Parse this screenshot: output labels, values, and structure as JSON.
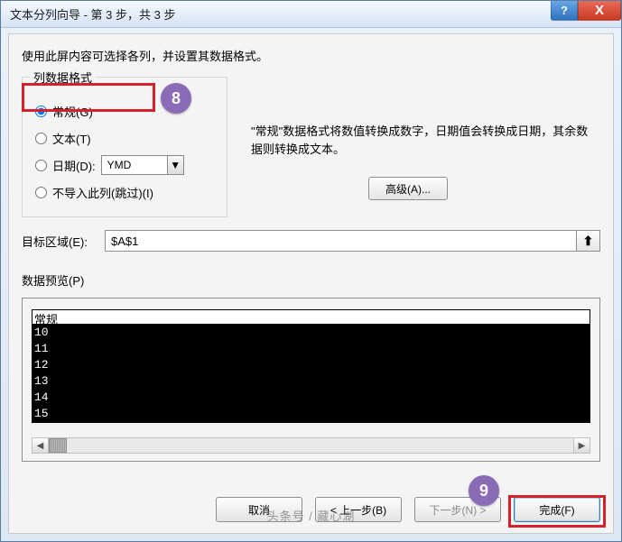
{
  "title": "文本分列向导 - 第 3 步，共 3 步",
  "intro": "使用此屏内容可选择各列，并设置其数据格式。",
  "format_group": {
    "legend": "列数据格式",
    "general": "常规(G)",
    "text": "文本(T)",
    "date": "日期(D):",
    "date_value": "YMD",
    "skip": "不导入此列(跳过)(I)"
  },
  "desc": "\"常规\"数据格式将数值转换成数字，日期值会转换成日期，其余数据则转换成文本。",
  "advanced": "高级(A)...",
  "dest_label": "目标区域(E):",
  "dest_value": "$A$1",
  "preview_label": "数据预览(P)",
  "preview_header": "常规",
  "preview_rows": [
    "10",
    "11",
    "12",
    "13",
    "14",
    "15"
  ],
  "buttons": {
    "cancel": "取消",
    "back": "< 上一步(B)",
    "next": "下一步(N) >",
    "finish": "完成(F)"
  },
  "badges": {
    "b8": "8",
    "b9": "9"
  },
  "watermark": "头条号 / 藏心湖",
  "icons": {
    "help": "?",
    "close": "X",
    "up_arrow": "⬆",
    "down_tri": "▼",
    "left_tri": "◀",
    "right_tri": "▶"
  }
}
